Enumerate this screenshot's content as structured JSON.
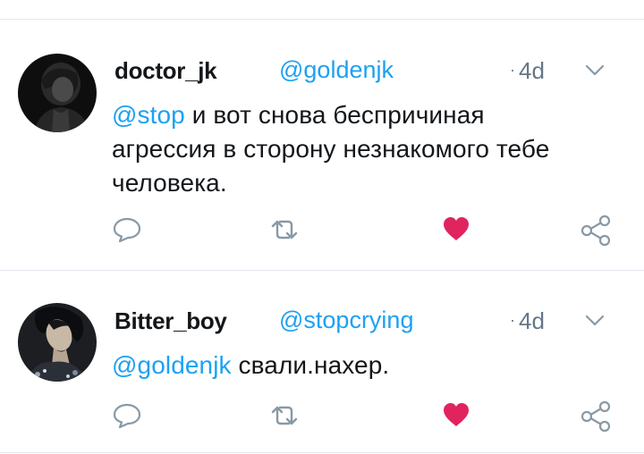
{
  "tweets": [
    {
      "name": "doctor_jk",
      "handle": "@goldenjk",
      "time": "4d",
      "reply_to": "@stop",
      "text_line1": " и вот снова беспричиная",
      "text_line2": "агрессия в сторону незнакомого тебе",
      "text_line3": "человека.",
      "liked": true
    },
    {
      "name": "Bitter_boy",
      "handle": "@stopcrying",
      "time": "4d",
      "reply_to": "@goldenjk",
      "text_line1": " свали.нахер.",
      "liked": true
    }
  ],
  "colors": {
    "accent": "#1da1f2",
    "like": "#e0245e",
    "icon_gray": "#8899a6",
    "text": "#14171a",
    "muted": "#657786"
  },
  "icons": {
    "reply": "speech-bubble",
    "retweet": "retweet-arrows",
    "like": "heart-filled",
    "share": "share-nodes",
    "menu": "chevron-down"
  }
}
